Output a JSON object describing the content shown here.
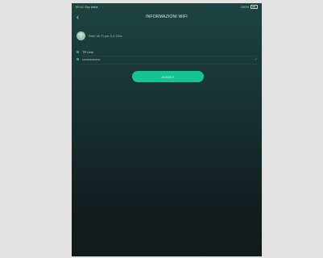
{
  "status_bar": {
    "time_carrier": "09:41 Sky Italia",
    "battery_text": "100%"
  },
  "nav": {
    "back_glyph": "‹",
    "title": "INFORMAZIONI WIFI"
  },
  "hint": {
    "icon": "wifi-icon",
    "text": "Rete Wi-Fi per 2,4 GHz"
  },
  "fields": {
    "ssid": "TP-Link",
    "password": "••••••••••••••••"
  },
  "actions": {
    "next_label": "AVANTI"
  },
  "colors": {
    "accent": "#17c392",
    "background_top": "#1d4340",
    "background_bottom": "#11191c"
  }
}
